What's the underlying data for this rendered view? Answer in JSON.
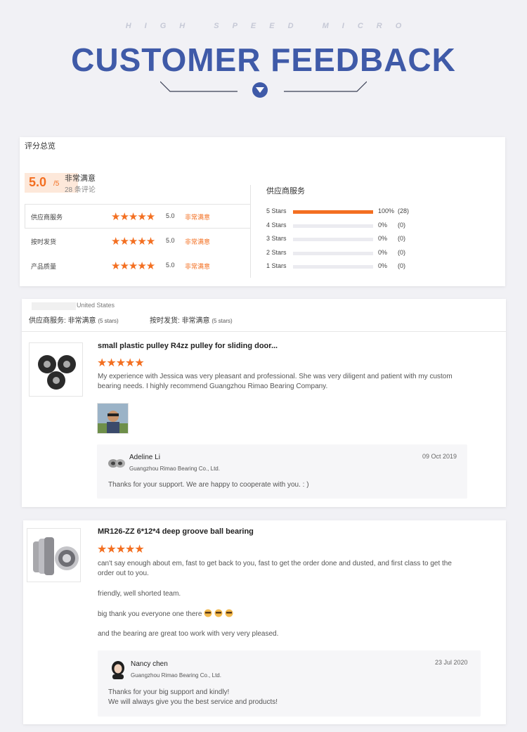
{
  "header": {
    "subtitle": "HIGH  SPEED  MICRO",
    "title": "CUSTOMER FEEDBACK"
  },
  "summary": {
    "heading": "评分总览",
    "score": "5.0",
    "score_of": "/5",
    "rating_label": "非常满意",
    "review_count": "28 条评论",
    "rows": [
      {
        "label": "供应商服务",
        "stars": "★★★★★",
        "value": "5.0",
        "desc": "非常满意"
      },
      {
        "label": "按时发货",
        "stars": "★★★★★",
        "value": "5.0",
        "desc": "非常满意"
      },
      {
        "label": "产品质量",
        "stars": "★★★★★",
        "value": "5.0",
        "desc": "非常满意"
      }
    ],
    "supplier_heading": "供应商服务",
    "distribution": [
      {
        "label": "5 Stars",
        "pct": "100%",
        "count": "(28)",
        "fraction": 1.0
      },
      {
        "label": "4 Stars",
        "pct": "0%",
        "count": "(0)",
        "fraction": 0
      },
      {
        "label": "3 Stars",
        "pct": "0%",
        "count": "(0)",
        "fraction": 0
      },
      {
        "label": "2 Stars",
        "pct": "0%",
        "count": "(0)",
        "fraction": 0
      },
      {
        "label": "1 Stars",
        "pct": "0%",
        "count": "(0)",
        "fraction": 0
      }
    ]
  },
  "review1": {
    "location": "United States",
    "meta_service_label": "供应商服务:",
    "meta_service_value": "非常满意",
    "meta_service_stars": "(5 stars)",
    "meta_ship_label": "按时发货:",
    "meta_ship_value": "非常满意",
    "meta_ship_stars": "(5 stars)",
    "title": "small plastic pulley R4zz pulley for sliding door...",
    "stars": "★★★★★",
    "text": "My experience with Jessica was very pleasant and professional. She was very diligent and patient with my custom bearing needs. I highly recommend Guangzhou Rimao Bearing Company.",
    "reply": {
      "name": "Adeline Li",
      "company": "Guangzhou Rimao Bearing Co., Ltd.",
      "date": "09 Oct 2019",
      "message": "Thanks for your support. We are happy to cooperate with you. : )"
    }
  },
  "review2": {
    "title": "MR126-ZZ 6*12*4 deep groove ball bearing",
    "stars": "★★★★★",
    "para1": "can't say enough about em, fast to get back to you, fast to get the order done and dusted, and first class to get the order out to you.",
    "para2": "friendly, well shorted team.",
    "para3": "big thank you everyone one there",
    "para4": "and the bearing are great too work with very very pleased.",
    "reply": {
      "name": "Nancy chen",
      "company": "Guangzhou Rimao Bearing Co., Ltd.",
      "date": "23 Jul 2020",
      "message1": "Thanks for your big support and kindly!",
      "message2": "We will always give you the best service and products!"
    }
  },
  "colors": {
    "accent": "#f36f21",
    "brand_blue": "#3f5aa8"
  }
}
